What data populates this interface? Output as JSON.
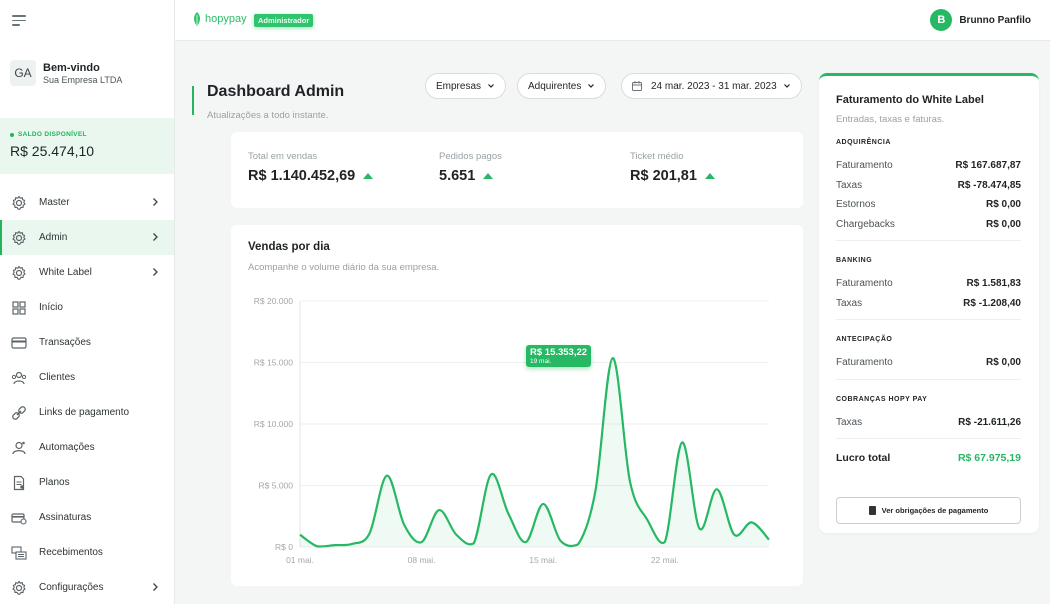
{
  "topbar": {
    "brand": "hopypay",
    "role_badge": "Administrador",
    "user_initial": "B",
    "user_name": "Brunno Panfilo"
  },
  "sidebar": {
    "company_initials": "GA",
    "welcome": "Bem-vindo",
    "company_name": "Sua Empresa LTDA",
    "balance_label": "SALDO DISPONÍVEL",
    "balance_value": "R$ 25.474,10",
    "items": [
      {
        "label": "Master",
        "icon": "gear-icon",
        "has_submenu": true,
        "active": false
      },
      {
        "label": "Admin",
        "icon": "gear-icon",
        "has_submenu": true,
        "active": true
      },
      {
        "label": "White Label",
        "icon": "gear-icon",
        "has_submenu": true,
        "active": false
      },
      {
        "label": "Início",
        "icon": "grid-icon",
        "has_submenu": false,
        "active": false
      },
      {
        "label": "Transações",
        "icon": "card-icon",
        "has_submenu": false,
        "active": false
      },
      {
        "label": "Clientes",
        "icon": "users-icon",
        "has_submenu": false,
        "active": false
      },
      {
        "label": "Links de pagamento",
        "icon": "link-icon",
        "has_submenu": false,
        "active": false
      },
      {
        "label": "Automações",
        "icon": "robot-icon",
        "has_submenu": false,
        "active": false
      },
      {
        "label": "Planos",
        "icon": "file-icon",
        "has_submenu": false,
        "active": false
      },
      {
        "label": "Assinaturas",
        "icon": "card-stack-icon",
        "has_submenu": false,
        "active": false
      },
      {
        "label": "Recebimentos",
        "icon": "cash-icon",
        "has_submenu": false,
        "active": false
      },
      {
        "label": "Configurações",
        "icon": "gear-icon",
        "has_submenu": true,
        "active": false
      }
    ]
  },
  "header": {
    "title": "Dashboard Admin",
    "subtitle": "Atualizações a todo instante.",
    "filter_companies": "Empresas",
    "filter_acquirers": "Adquirentes",
    "date_range": "24 mar. 2023 - 31 mar. 2023"
  },
  "kpis": [
    {
      "label": "Total em vendas",
      "value": "R$ 1.140.452,69"
    },
    {
      "label": "Pedidos pagos",
      "value": "5.651"
    },
    {
      "label": "Ticket médio",
      "value": "R$ 201,81"
    }
  ],
  "chart": {
    "title": "Vendas por dia",
    "subtitle": "Acompanhe o volume diário da sua empresa.",
    "tooltip_value": "R$ 15.353,22",
    "tooltip_date": "19 mai."
  },
  "chart_data": {
    "type": "line",
    "title": "Vendas por dia",
    "xlabel": "",
    "ylabel": "",
    "ylim": [
      0,
      20000
    ],
    "yticks": [
      "R$ 0",
      "R$ 5.000",
      "R$ 10.000",
      "R$ 15.000",
      "R$ 20.000"
    ],
    "xticks": [
      "01 mai.",
      "08 mai.",
      "15 mai.",
      "22 mai."
    ],
    "grid": true,
    "series_color": "#27b864",
    "x": [
      "01 mai.",
      "02 mai.",
      "03 mai.",
      "04 mai.",
      "05 mai.",
      "06 mai.",
      "07 mai.",
      "08 mai.",
      "09 mai.",
      "10 mai.",
      "11 mai.",
      "12 mai.",
      "13 mai.",
      "14 mai.",
      "15 mai.",
      "16 mai.",
      "17 mai.",
      "18 mai.",
      "19 mai.",
      "20 mai.",
      "21 mai.",
      "22 mai.",
      "23 mai.",
      "24 mai.",
      "25 mai.",
      "26 mai.",
      "27 mai.",
      "28 mai."
    ],
    "values": [
      1000,
      50,
      150,
      250,
      1100,
      5800,
      1800,
      400,
      3000,
      1000,
      300,
      5900,
      2700,
      400,
      3500,
      500,
      200,
      4500,
      15353,
      5300,
      2200,
      400,
      8500,
      1500,
      4700,
      1000,
      2000,
      600
    ]
  },
  "summary": {
    "title": "Faturamento do White Label",
    "subtitle": "Entradas, taxas e faturas.",
    "sections": [
      {
        "heading": "ADQUIRÊNCIA",
        "rows": [
          {
            "label": "Faturamento",
            "value": "R$ 167.687,87"
          },
          {
            "label": "Taxas",
            "value": "R$ -78.474,85"
          },
          {
            "label": "Estornos",
            "value": "R$ 0,00"
          },
          {
            "label": "Chargebacks",
            "value": "R$ 0,00"
          }
        ]
      },
      {
        "heading": "BANKING",
        "rows": [
          {
            "label": "Faturamento",
            "value": "R$ 1.581,83"
          },
          {
            "label": "Taxas",
            "value": "R$ -1.208,40"
          }
        ]
      },
      {
        "heading": "ANTECIPAÇÃO",
        "rows": [
          {
            "label": "Faturamento",
            "value": "R$ 0,00"
          }
        ]
      },
      {
        "heading": "COBRANÇAS HOPY PAY",
        "rows": [
          {
            "label": "Taxas",
            "value": "R$ -21.611,26"
          }
        ]
      }
    ],
    "total_label": "Lucro total",
    "total_value": "R$ 67.975,19",
    "button_label": "Ver obrigações de pagamento",
    "accent_color": "#27b864"
  }
}
